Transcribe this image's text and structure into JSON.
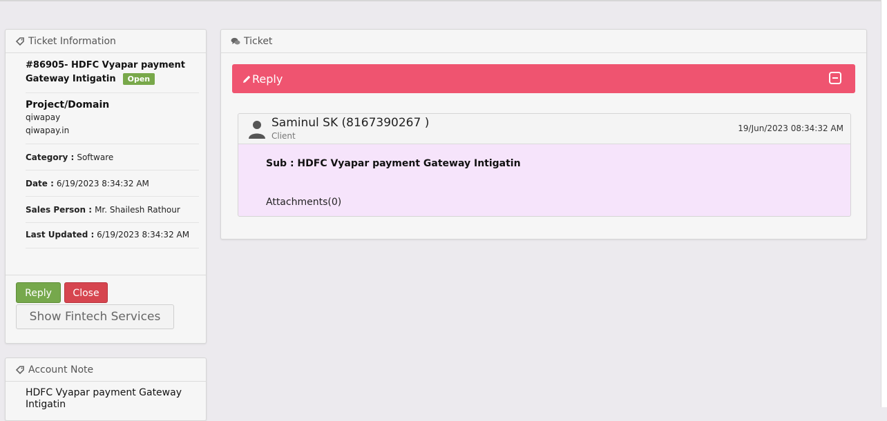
{
  "info_panel": {
    "title": "Ticket Information",
    "ticket_title": "#86905- HDFC Vyapar payment Gateway Intigatin",
    "status": "Open",
    "project_label": "Project/Domain",
    "project_name": "qiwapay",
    "project_domain": "qiwapay.in",
    "category_label": "Category :",
    "category_value": "Software",
    "date_label": "Date :",
    "date_value": "6/19/2023 8:34:32 AM",
    "sales_label": "Sales Person :",
    "sales_value": "Mr. Shailesh Rathour",
    "updated_label": "Last Updated :",
    "updated_value": "6/19/2023 8:34:32 AM",
    "buttons": {
      "reply": "Reply",
      "close": "Close",
      "fintech": "Show Fintech Services"
    }
  },
  "note_panel": {
    "title": "Account Note",
    "text": "HDFC Vyapar payment Gateway Intigatin"
  },
  "ticket_panel": {
    "title": "Ticket",
    "reply_bar_label": "Reply",
    "message": {
      "author": "Saminul SK (8167390267 )",
      "role": "Client",
      "date": "19/Jun/2023 08:34:32 AM",
      "subject": "Sub : HDFC Vyapar payment Gateway Intigatin",
      "attachments": "Attachments(0)"
    }
  },
  "colors": {
    "reply_bar": "#ef5470",
    "message_bg": "#f6e4fb",
    "status_badge": "#78a84a",
    "reply_button": "#76a84c",
    "close_button": "#d6454f"
  },
  "icons": {
    "ticket_info": "tag-icon",
    "account_note": "tag-icon",
    "ticket": "comments-icon",
    "reply_bar": "pencil-icon",
    "collapse": "minus-square-icon",
    "avatar": "user-icon"
  }
}
